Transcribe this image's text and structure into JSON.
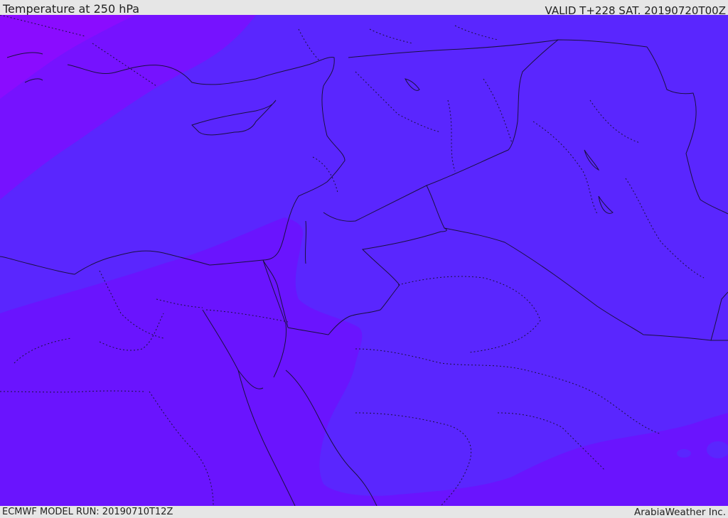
{
  "header": {
    "title": "Temperature at 250 hPa",
    "valid_time": "VALID T+228 SAT. 20190720T00Z"
  },
  "footer": {
    "model_run": "ECMWF MODEL RUN: 20190710T12Z",
    "credit": "ArabiaWeather Inc."
  },
  "map": {
    "field": "Temperature",
    "level": "250 hPa",
    "colors": {
      "band_coldest": "#8a0cff",
      "band_cold": "#7612ff",
      "band_warm": "#6a14fe",
      "band_warmer": "#5a26fe",
      "boundary_line": "#1a1040"
    }
  }
}
